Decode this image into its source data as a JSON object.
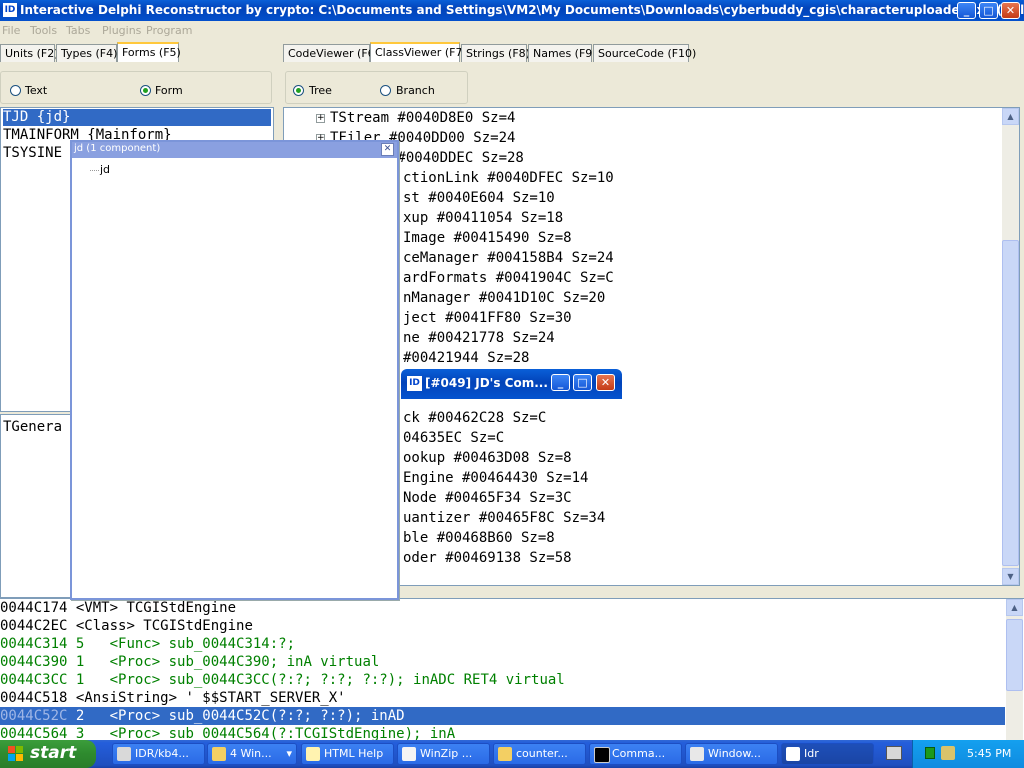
{
  "window": {
    "title": "Interactive Delphi Reconstructor by crypto: C:\\Documents and Settings\\VM2\\My Documents\\Downloads\\cyberbuddy_cgis\\characteruploader.exe (Del...",
    "icon_text": "ID",
    "min": "_",
    "max": "□",
    "close": "✕"
  },
  "menu": [
    "File",
    "Tools",
    "Tabs",
    "Plugins",
    "Program"
  ],
  "left_tabs": [
    "Units (F2)",
    "Types (F4)",
    "Forms (F5)"
  ],
  "left_radios": {
    "text": "Text",
    "form": "Form"
  },
  "forms_list": [
    "TJD {jd}",
    "TMAINFORM {Mainform}",
    "TSYSINE"
  ],
  "lower_left_text": "TGenera",
  "right_tabs": [
    "CodeViewer (F6)",
    "ClassViewer (F7)",
    "Strings (F8)",
    "Names (F9)",
    "SourceCode (F10)"
  ],
  "right_radios": {
    "tree": "Tree",
    "branch": "Branch"
  },
  "tree_lines": [
    "TStream #0040D8E0 Sz=4",
    "TFiler #0040DD00 Sz=24",
    "        #0040DDEC Sz=28",
    "ctionLink #0040DFEC Sz=10",
    "st #0040E604 Sz=10",
    "xup #00411054 Sz=18",
    "Image #00415490 Sz=8",
    "ceManager #004158B4 Sz=24",
    "ardFormats #0041904C Sz=C",
    "nManager #0041D10C Sz=20",
    "ject #0041FF80 Sz=30",
    "ne #00421778 Sz=24",
    "#00421944 Sz=28",
    "",
    "",
    "ck #00462C28 Sz=C",
    "04635EC Sz=C",
    "ookup #00463D08 Sz=8",
    "Engine #00464430 Sz=14",
    "Node #00465F34 Sz=3C",
    "uantizer #00465F8C Sz=34",
    "ble #00468B60 Sz=8",
    "oder #00469138 Sz=58"
  ],
  "jd_window": {
    "title": "jd (1 component)",
    "item": "jd",
    "close": "✕"
  },
  "small_window": {
    "title": "[#049] JD's Com...",
    "min": "_",
    "max": "□",
    "close": "✕"
  },
  "code_lines": [
    {
      "addr": "0044C174",
      "rest": " <VMT> TCGIStdEngine",
      "green": false,
      "selected": false
    },
    {
      "addr": "0044C2EC",
      "rest": " <Class> TCGIStdEngine",
      "green": false,
      "selected": false
    },
    {
      "addr": "0044C314",
      "rest": " 5   <Func> sub_0044C314:?;",
      "green": true,
      "selected": false
    },
    {
      "addr": "0044C390",
      "rest": " 1   <Proc> sub_0044C390; inA virtual",
      "green": true,
      "selected": false
    },
    {
      "addr": "0044C3CC",
      "rest": " 1   <Proc> sub_0044C3CC(?:?; ?:?; ?:?); inADC RET4 virtual",
      "green": true,
      "selected": false
    },
    {
      "addr": "0044C518",
      "rest": " <AnsiString> ' $$START_SERVER_X'",
      "green": false,
      "selected": false
    },
    {
      "addr": "0044C52C",
      "rest": " 2   <Proc> sub_0044C52C(?:?; ?:?); inAD",
      "green": false,
      "selected": true
    },
    {
      "addr": "0044C564",
      "rest": " 3   <Proc> sub_0044C564(?:TCGIStdEngine); inA",
      "green": true,
      "selected": false
    }
  ],
  "taskbar": {
    "start": "start",
    "tasks": [
      "IDR/kb4...",
      "4 Win...",
      "HTML Help",
      "WinZip ...",
      "counter...",
      "Comma...",
      "Window...",
      "Idr"
    ],
    "clock": "5:45 PM"
  },
  "colors": {
    "titlebar": "#0243b9",
    "selection": "#316ac5",
    "code_green": "#008000",
    "taskbar": "#245edb",
    "start": "#2e8a2e"
  }
}
